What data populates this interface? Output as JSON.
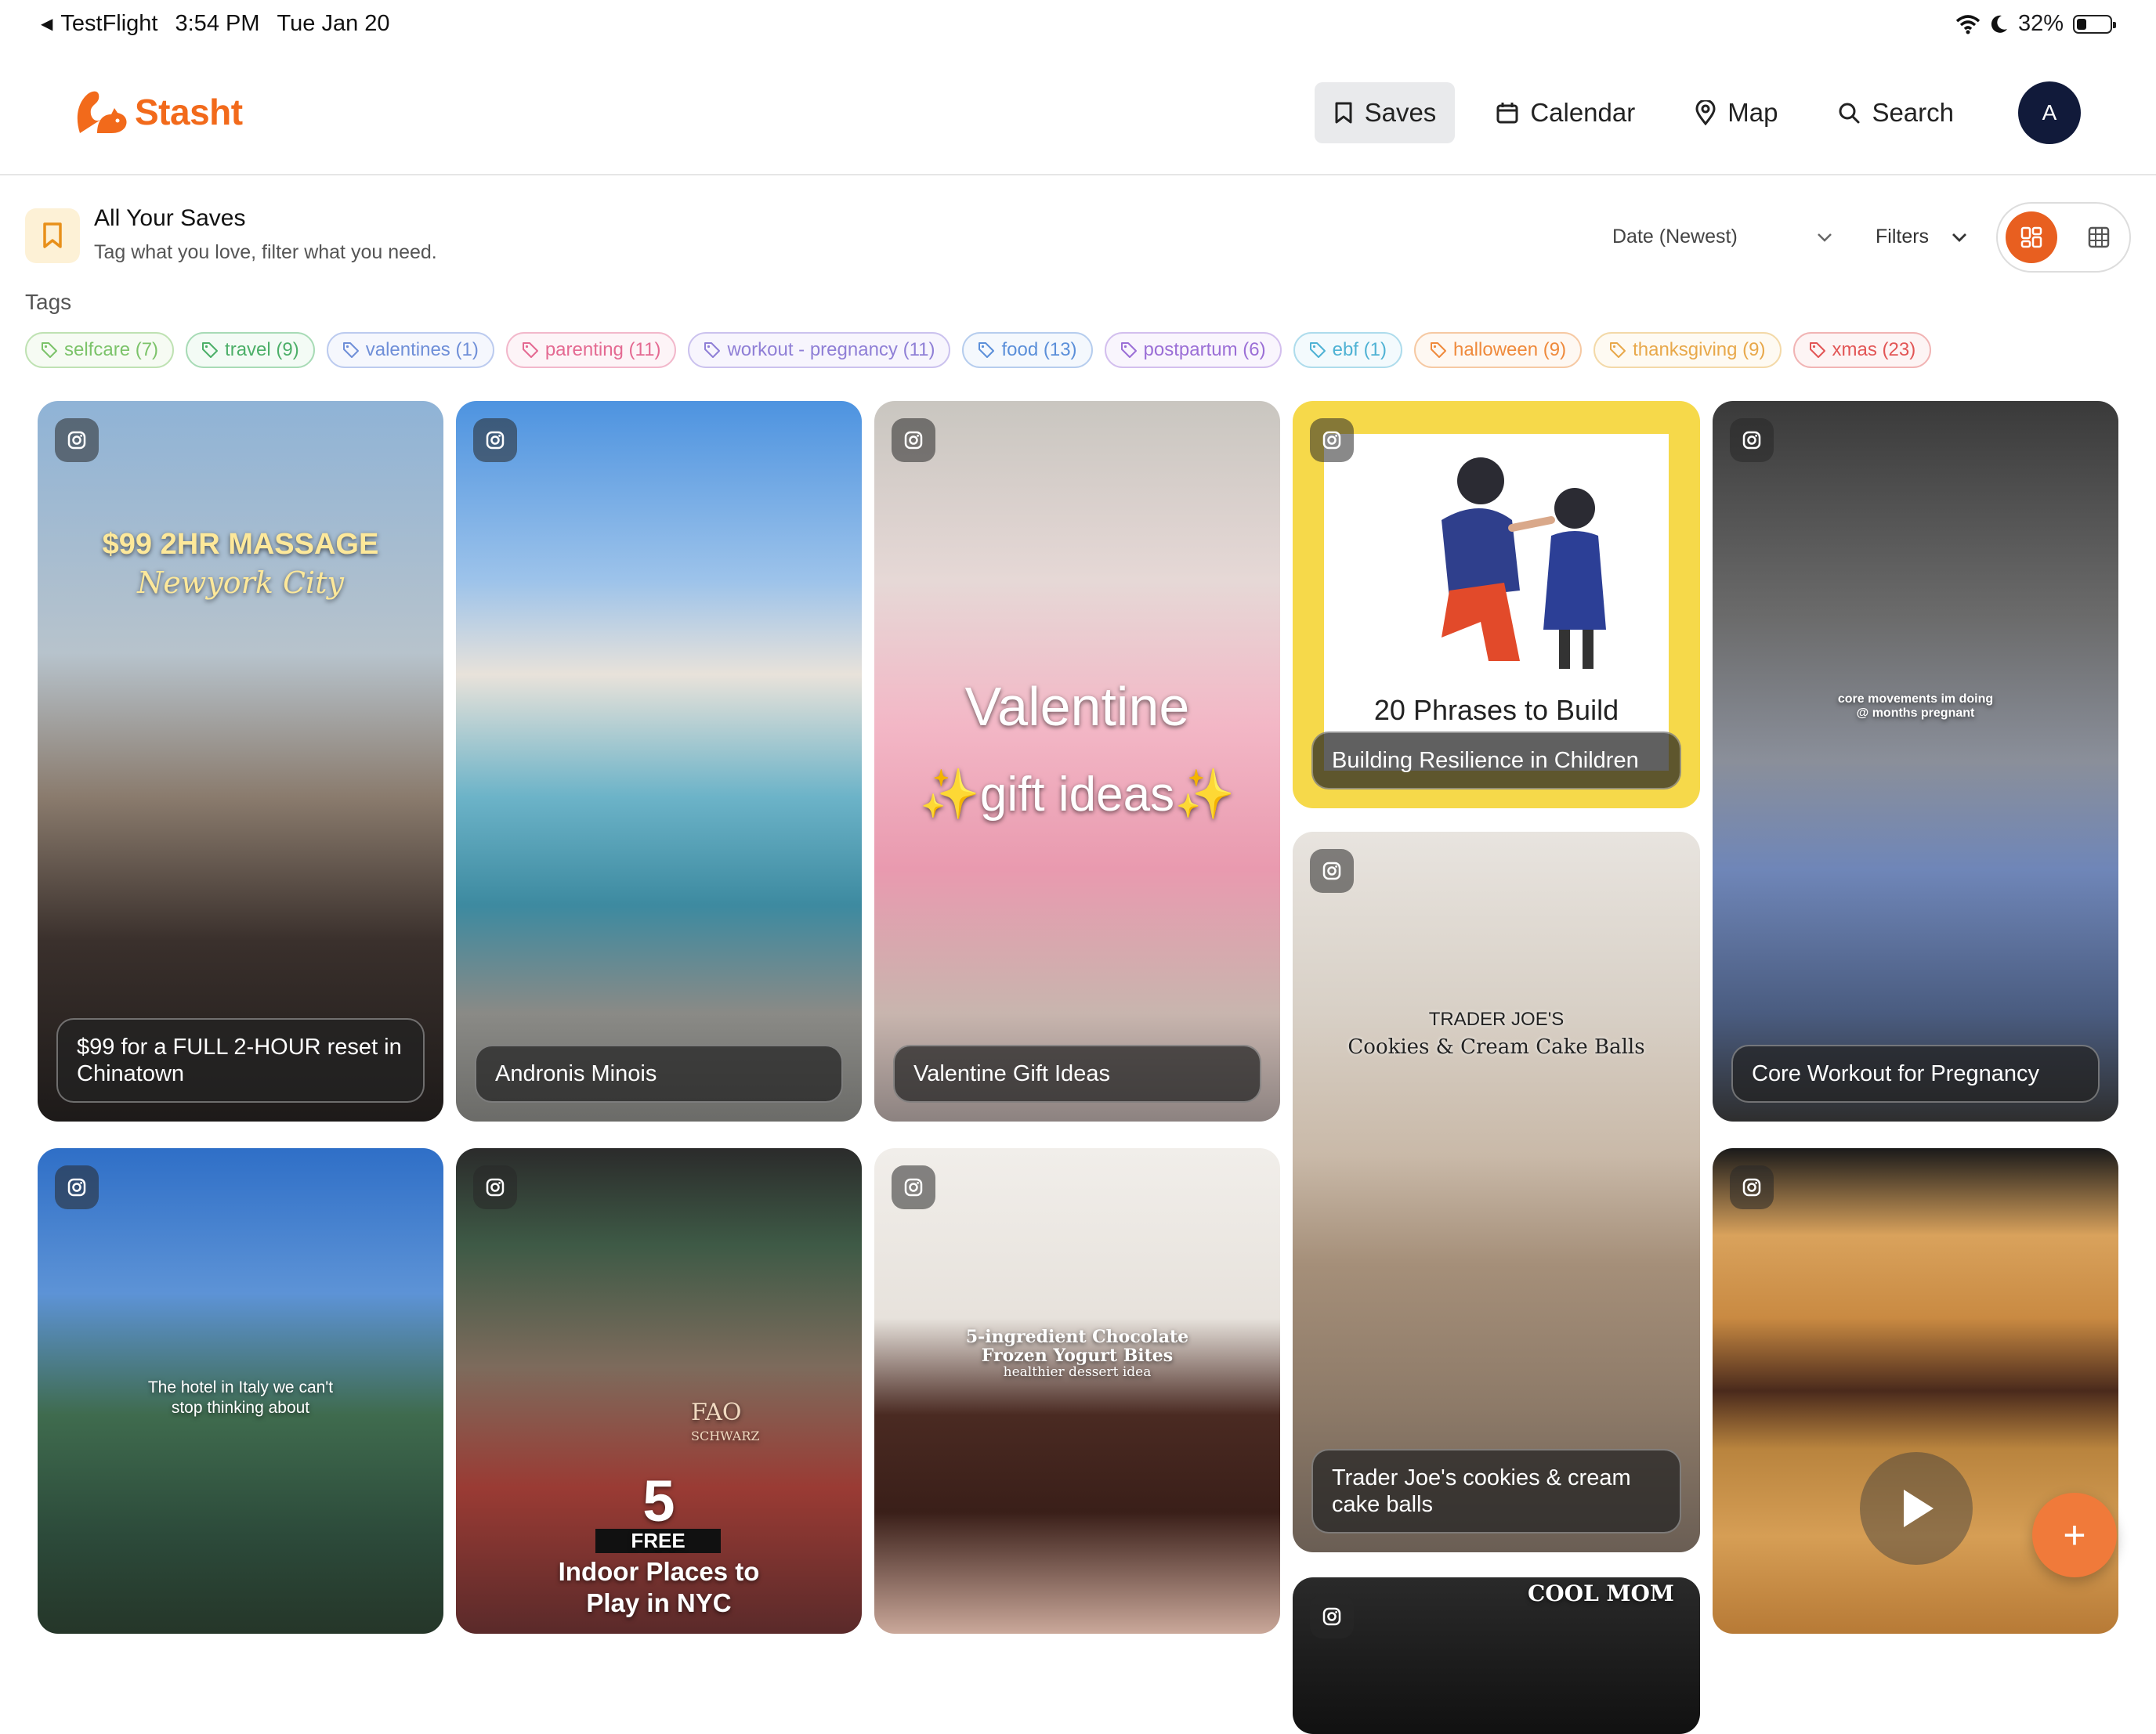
{
  "status_bar": {
    "back_app": "TestFlight",
    "time": "3:54 PM",
    "date": "Tue Jan 20",
    "battery": "32%"
  },
  "header": {
    "logo_text": "Stasht",
    "nav": [
      {
        "label": "Saves",
        "icon": "bookmark-icon",
        "active": true
      },
      {
        "label": "Calendar",
        "icon": "calendar-icon",
        "active": false
      },
      {
        "label": "Map",
        "icon": "map-pin-icon",
        "active": false
      },
      {
        "label": "Search",
        "icon": "search-icon",
        "active": false
      }
    ],
    "avatar_initial": "A"
  },
  "saves": {
    "title": "All Your Saves",
    "subtitle": "Tag what you love, filter what you need.",
    "sort_label": "Date (Newest)",
    "filters_label": "Filters",
    "view_mode": "masonry"
  },
  "tags": {
    "label": "Tags",
    "items": [
      {
        "label": "selfcare (7)",
        "color": "#7cc36a"
      },
      {
        "label": "travel (9)",
        "color": "#4caf68"
      },
      {
        "label": "valentines (1)",
        "color": "#6f8fd8"
      },
      {
        "label": "parenting (11)",
        "color": "#e46a92"
      },
      {
        "label": "workout - pregnancy (11)",
        "color": "#8f7fd6"
      },
      {
        "label": "food (13)",
        "color": "#5b8fd9"
      },
      {
        "label": "postpartum (6)",
        "color": "#9b6fd6"
      },
      {
        "label": "ebf (1)",
        "color": "#4fb2d4"
      },
      {
        "label": "halloween (9)",
        "color": "#ef8a3c"
      },
      {
        "label": "thanksgiving (9)",
        "color": "#e8a84a"
      },
      {
        "label": "xmas (23)",
        "color": "#e25555"
      }
    ]
  },
  "cards": [
    {
      "caption": "$99 for a FULL 2-HOUR reset in Chinatown",
      "overlay_lines": [
        "$99 2HR MASSAGE",
        "Newyork City"
      ]
    },
    {
      "caption": "Andronis Minois"
    },
    {
      "caption": "Valentine Gift Ideas",
      "overlay_lines": [
        "Valentine",
        "✨gift ideas✨"
      ]
    },
    {
      "caption": "Building Resilience in Children",
      "overlay_lines": [
        "20 Phrases to Build"
      ]
    },
    {
      "caption": "Core Workout for Pregnancy",
      "overlay_lines": [
        "core movements im doing",
        "@ months pregnant"
      ]
    },
    {
      "caption": "Trader Joe's cookies & cream cake balls",
      "overlay_lines": [
        "TRADER JOE'S",
        "Cookies & Cream Cake Balls"
      ]
    },
    {
      "overlay_lines": [
        "The hotel in Italy we can't",
        "stop thinking about"
      ]
    },
    {
      "overlay_lines": [
        "5",
        "FREE",
        "Indoor Places to",
        "Play in NYC",
        "FAO",
        "SCHWARZ"
      ]
    },
    {
      "overlay_lines": [
        "5-ingredient Chocolate",
        "Frozen Yogurt Bites",
        "healthier dessert idea"
      ]
    },
    {
      "overlay_lines": []
    },
    {
      "overlay_lines": [
        "COOL MOM"
      ]
    }
  ],
  "fab_label": "+"
}
